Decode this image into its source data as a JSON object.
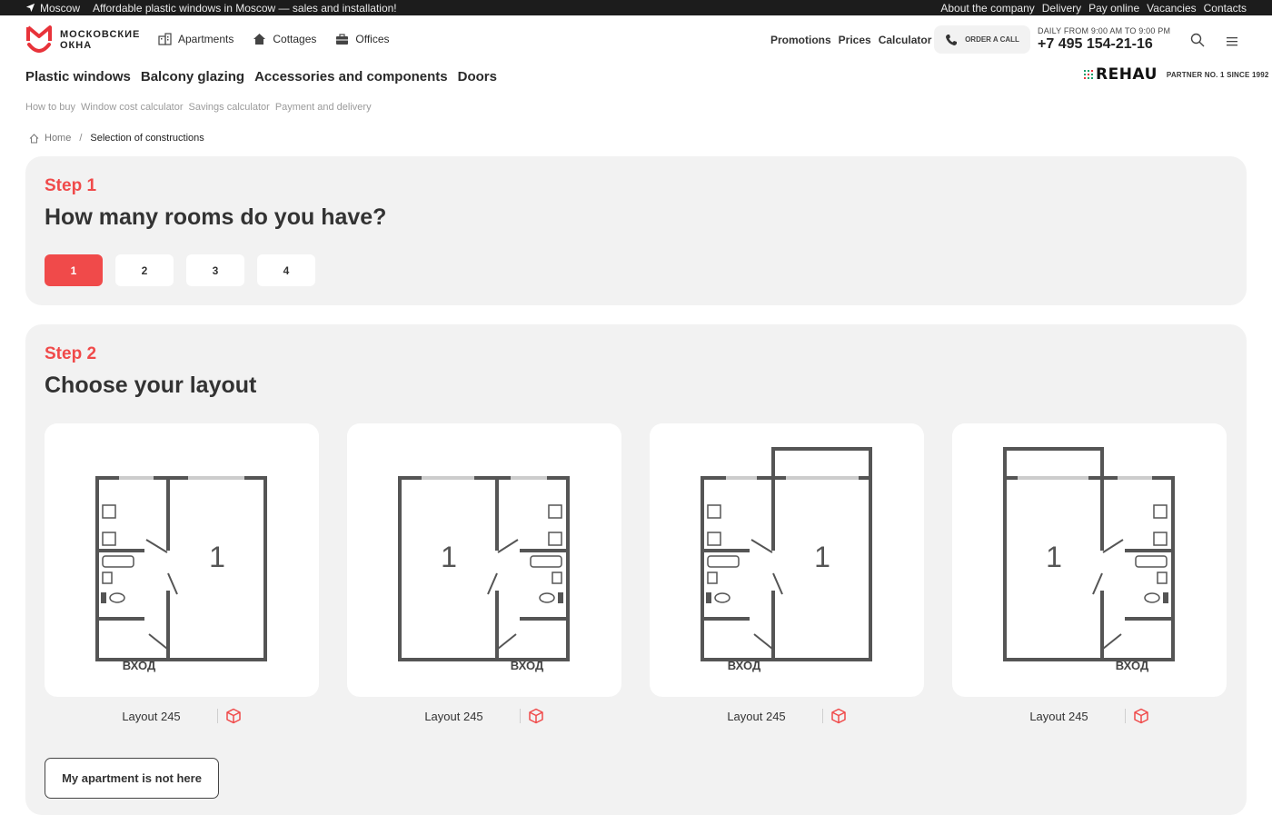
{
  "topbar": {
    "city": "Moscow",
    "tagline": "Affordable plastic windows in Moscow — sales and installation!",
    "links": [
      "About the company",
      "Delivery",
      "Pay online",
      "Vacancies",
      "Contacts"
    ]
  },
  "header": {
    "logo_line1": "МОСКОВСКИЕ",
    "logo_line2": "ОКНА",
    "categories": [
      "Apartments",
      "Cottages",
      "Offices"
    ],
    "links": [
      "Promotions",
      "Prices",
      "Calculator"
    ],
    "order_call": "ORDER A CALL",
    "hours": "DAILY FROM 9:00 AM TO 9:00 PM",
    "phone": "+7 495 154-21-16"
  },
  "main_nav": [
    "Plastic windows",
    "Balcony glazing",
    "Accessories and components",
    "Doors"
  ],
  "partner": {
    "logo": "REHAU",
    "caption": "PARTNER NO. 1 SINCE 1992"
  },
  "sub_nav": [
    "How to buy",
    "Window cost calculator",
    "Savings calculator",
    "Payment and delivery"
  ],
  "breadcrumb": {
    "home": "Home",
    "current": "Selection of constructions"
  },
  "step1": {
    "step_label": "Step 1",
    "question": "How many rooms do you have?",
    "options": [
      "1",
      "2",
      "3",
      "4"
    ],
    "selected": "1"
  },
  "step2": {
    "step_label": "Step 2",
    "question": "Choose your layout",
    "layouts": [
      {
        "name": "Layout 245",
        "room_number": "1",
        "entrance": "ВХОД"
      },
      {
        "name": "Layout 245",
        "room_number": "1",
        "entrance": "ВХОД"
      },
      {
        "name": "Layout 245",
        "room_number": "1",
        "entrance": "ВХОД"
      },
      {
        "name": "Layout 245",
        "room_number": "1",
        "entrance": "ВХОД"
      }
    ],
    "not_here_button": "My apartment is not here"
  },
  "colors": {
    "accent": "#f04a4a",
    "topbar": "#1c1c1c",
    "panel": "#f2f2f2"
  }
}
